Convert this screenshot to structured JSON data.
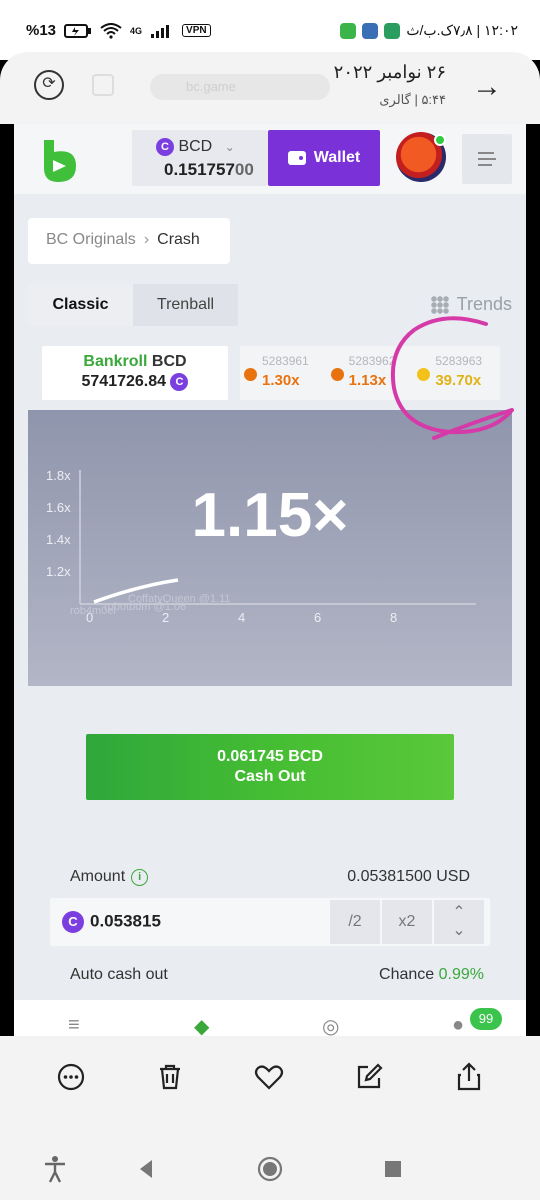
{
  "status_bar": {
    "battery": "%13",
    "network": "4G",
    "vpn": "VPN",
    "time": "۱۲:۰۲ | ۷٫۸ک.ب/ث"
  },
  "gallery": {
    "date": "۲۶ نوامبر ۲۰۲۲",
    "subtitle": "۵:۴۴ | گالری",
    "url_ghost": "bc.game"
  },
  "site": {
    "currency": "BCD",
    "coin_symbol": "C",
    "balance_main": "0.151757",
    "balance_fade": "00",
    "wallet_label": "Wallet",
    "breadcrumb": {
      "parent": "BC Originals",
      "separator": "›",
      "current": "Crash"
    },
    "tabs": [
      {
        "label": "Classic",
        "active": true
      },
      {
        "label": "Trenball",
        "active": false
      }
    ],
    "trends_label": "Trends",
    "bankroll": {
      "label_green": "Bankroll",
      "label_currency": "BCD",
      "value": "5741726.84"
    },
    "history": [
      {
        "id": "5283961",
        "mult": "1.30x",
        "color": "#e8730e"
      },
      {
        "id": "5283962",
        "mult": "1.13x",
        "color": "#e8730e"
      },
      {
        "id": "5283963",
        "mult": "39.70x",
        "color": "#f2c21b"
      }
    ],
    "graph": {
      "current_multiplier": "1.15×",
      "y_ticks": [
        "1.8x",
        "1.6x",
        "1.4x",
        "1.2x"
      ],
      "x_ticks": [
        "0",
        "2",
        "4",
        "6",
        "8"
      ],
      "ghost_players": [
        "CoffatyQueen @1.11",
        "robotbdm @1.06",
        "rob4m0el"
      ]
    },
    "cashout": {
      "amount": "0.061745 BCD",
      "label": "Cash Out"
    },
    "amount": {
      "label": "Amount",
      "usd": "0.05381500 USD",
      "value": "0.053815",
      "half": "/2",
      "double": "x2"
    },
    "auto_cash_out_label": "Auto cash out",
    "chance": {
      "label": "Chance",
      "value": "0.99%"
    },
    "chat_badge": "99"
  },
  "colors": {
    "accent_purple": "#7a32d8",
    "green": "#3aa83a",
    "annotation": "#d63aa8"
  }
}
